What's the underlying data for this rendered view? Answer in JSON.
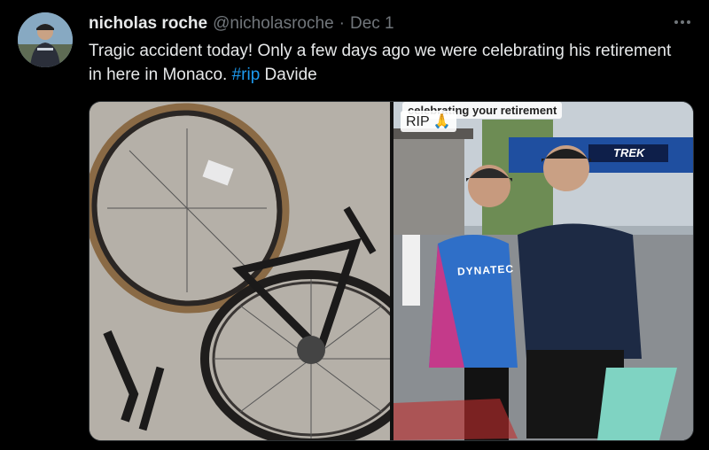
{
  "author": {
    "display_name": "nicholas roche",
    "handle": "@nicholasroche",
    "separator": "·",
    "date": "Dec 1"
  },
  "more_icon": "more-horizontal-icon",
  "tweet": {
    "text_before": "Tragic accident today! Only a few days ago we were celebrating his retirement in here in Monaco. ",
    "hashtag": "#rip",
    "text_after": " Davide"
  },
  "media": {
    "photo_right": {
      "caption": "celebrating your retirement",
      "rip_label": "RIP 🙏",
      "jersey_text": "DYNATEC",
      "banner_text": "TREK"
    }
  },
  "colors": {
    "background": "#000000",
    "text": "#e7e9ea",
    "muted": "#71767b",
    "link": "#1d9bf0",
    "border": "#2f3336"
  }
}
